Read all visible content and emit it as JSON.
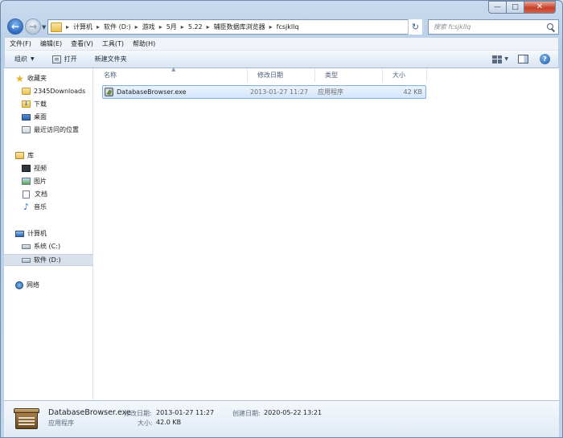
{
  "window": {
    "minimize_glyph": "—",
    "maximize_glyph": "□",
    "close_glyph": "✕"
  },
  "address": {
    "crumbs": [
      "计算机",
      "软件 (D:)",
      "游戏",
      "5月",
      "5.22",
      "辅臣数据库浏览器",
      "fcsjkllq"
    ],
    "separator": "▸",
    "search_placeholder": "搜索 fcsjkllq"
  },
  "menu": [
    "文件(F)",
    "编辑(E)",
    "查看(V)",
    "工具(T)",
    "帮助(H)"
  ],
  "commands": {
    "organize": "组织",
    "open": "打开",
    "new_folder": "新建文件夹",
    "help_glyph": "?"
  },
  "nav": {
    "favorites": {
      "label": "收藏夹",
      "items": [
        "2345Downloads",
        "下载",
        "桌面",
        "最近访问的位置"
      ]
    },
    "libraries": {
      "label": "库",
      "items": [
        "视频",
        "图片",
        "文档",
        "音乐"
      ]
    },
    "computer": {
      "label": "计算机",
      "items": [
        "系统 (C:)",
        "软件 (D:)"
      ],
      "selected": "软件 (D:)"
    },
    "network": {
      "label": "网络"
    }
  },
  "columns": {
    "name": "名称",
    "date": "修改日期",
    "type": "类型",
    "size": "大小"
  },
  "files": [
    {
      "name": "DatabaseBrowser.exe",
      "date": "2013-01-27 11:27",
      "type": "应用程序",
      "size": "42 KB"
    }
  ],
  "details": {
    "name": "DatabaseBrowser.exe",
    "type": "应用程序",
    "modified_label": "修改日期:",
    "modified": "2013-01-27 11:27",
    "created_label": "创建日期:",
    "created": "2020-05-22 13:21",
    "size_label": "大小:",
    "size": "42.0 KB"
  }
}
